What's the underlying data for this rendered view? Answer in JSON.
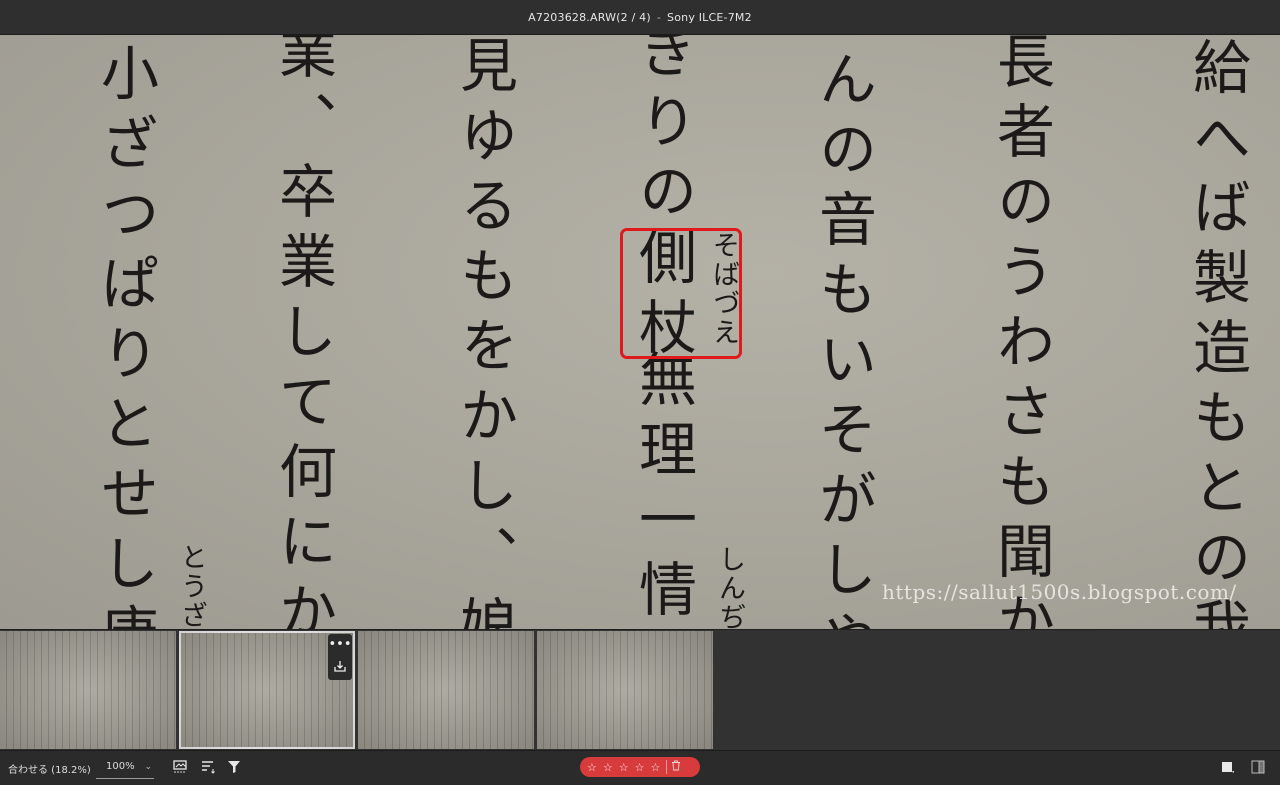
{
  "titlebar": {
    "filename": "A7203628.ARW(2 / 4)",
    "separator": "-",
    "camera": "Sony ILCE-7M2"
  },
  "image": {
    "columns": [
      "給へば製造もとの我等",
      "長者のうわさも聞かぜ",
      "んの音もいそがしや名",
      "ぎりの",
      "無理一情死",
      "見ゆるもをかし、娘は",
      "業、卒業して何にかた",
      "とうざ",
      "小ざつぱりとせし唐桟"
    ],
    "highlight_word": "側杖",
    "ruby_highlight": "そばづえ",
    "ruby_lower": "しんぢ",
    "watermark": "https://sallut1500s.blogspot.com/"
  },
  "filmstrip": {
    "thumbnails": [
      {
        "name": "A7203627.ARW",
        "selected": false
      },
      {
        "name": "A7203628.ARW",
        "selected": true
      },
      {
        "name": "A7203629.ARW",
        "selected": false
      },
      {
        "name": "A7203630.ARW",
        "selected": false
      }
    ],
    "more_icon": "ellipsis-icon",
    "export_icon": "download-icon"
  },
  "statusbar": {
    "fit_label": "合わせる (18.2%)",
    "zoom_value": "100%",
    "rating_stars": [
      "☆",
      "☆",
      "☆",
      "☆",
      "☆"
    ],
    "accent_color": "#d83b3b"
  }
}
